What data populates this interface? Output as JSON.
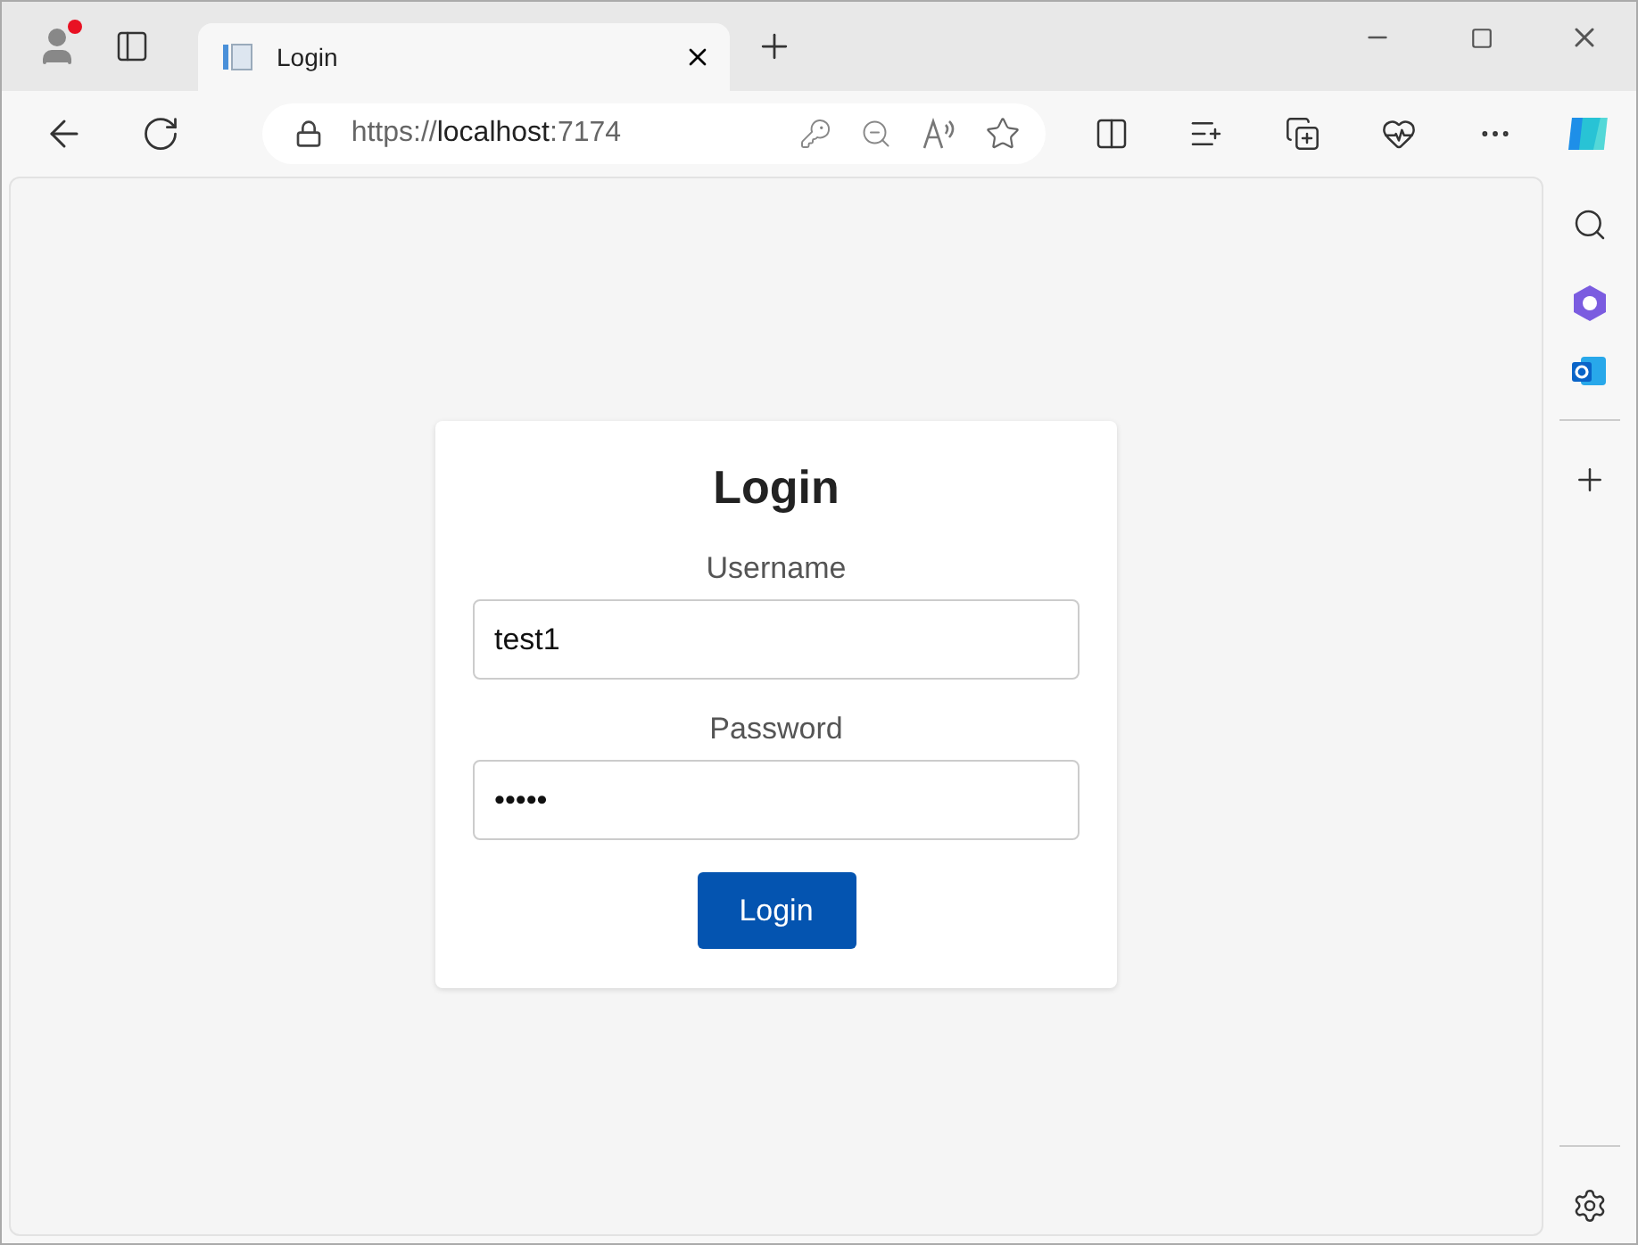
{
  "tab": {
    "title": "Login",
    "selected": true
  },
  "address": {
    "scheme": "https://",
    "host": "localhost",
    "port": ":7174"
  },
  "login": {
    "title": "Login",
    "fields": [
      {
        "label": "Username",
        "value": "test1"
      },
      {
        "label": "Password",
        "value": "•••••"
      }
    ],
    "button": "Login"
  }
}
